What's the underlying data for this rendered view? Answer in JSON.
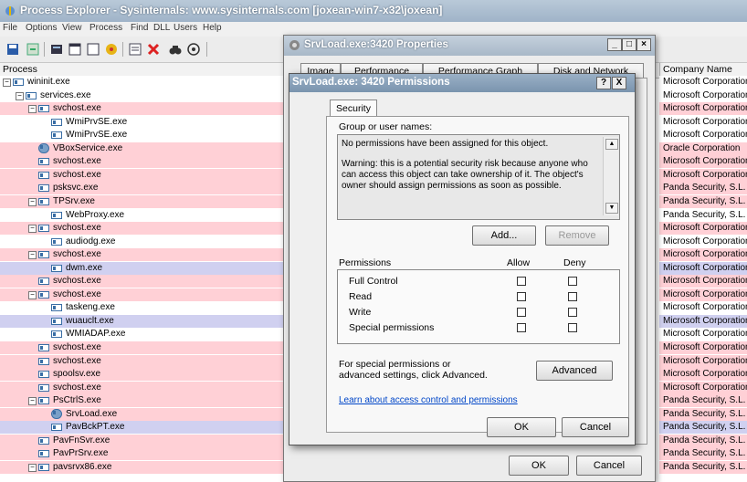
{
  "window": {
    "title": "Process Explorer - Sysinternals: www.sysinternals.com [joxean-win7-x32\\joxean]"
  },
  "menu": [
    "File",
    "Options",
    "View",
    "Process",
    "Find",
    "DLL",
    "Users",
    "Help"
  ],
  "columns": {
    "process": "Process",
    "company": "Company Name"
  },
  "processes": [
    {
      "name": "wininit.exe",
      "indent": 0,
      "toggle": "minus",
      "bg": "#ffffff"
    },
    {
      "name": "services.exe",
      "indent": 1,
      "toggle": "minus",
      "bg": "#ffffff"
    },
    {
      "name": "svchost.exe",
      "indent": 2,
      "toggle": "minus",
      "bg": "#ffd0d6"
    },
    {
      "name": "WmiPrvSE.exe",
      "indent": 3,
      "toggle": "",
      "bg": "#ffffff"
    },
    {
      "name": "WmiPrvSE.exe",
      "indent": 3,
      "toggle": "",
      "bg": "#ffffff"
    },
    {
      "name": "VBoxService.exe",
      "indent": 2,
      "toggle": "",
      "bg": "#ffd0d6",
      "icon": "gear"
    },
    {
      "name": "svchost.exe",
      "indent": 2,
      "toggle": "",
      "bg": "#ffd0d6"
    },
    {
      "name": "svchost.exe",
      "indent": 2,
      "toggle": "",
      "bg": "#ffd0d6"
    },
    {
      "name": "psksvc.exe",
      "indent": 2,
      "toggle": "",
      "bg": "#ffd0d6"
    },
    {
      "name": "TPSrv.exe",
      "indent": 2,
      "toggle": "minus",
      "bg": "#ffd0d6"
    },
    {
      "name": "WebProxy.exe",
      "indent": 3,
      "toggle": "",
      "bg": "#ffffff"
    },
    {
      "name": "svchost.exe",
      "indent": 2,
      "toggle": "minus",
      "bg": "#ffd0d6"
    },
    {
      "name": "audiodg.exe",
      "indent": 3,
      "toggle": "",
      "bg": "#ffffff"
    },
    {
      "name": "svchost.exe",
      "indent": 2,
      "toggle": "minus",
      "bg": "#ffd0d6"
    },
    {
      "name": "dwm.exe",
      "indent": 3,
      "toggle": "",
      "bg": "#d0d0f0"
    },
    {
      "name": "svchost.exe",
      "indent": 2,
      "toggle": "",
      "bg": "#ffd0d6"
    },
    {
      "name": "svchost.exe",
      "indent": 2,
      "toggle": "minus",
      "bg": "#ffd0d6"
    },
    {
      "name": "taskeng.exe",
      "indent": 3,
      "toggle": "",
      "bg": "#ffffff"
    },
    {
      "name": "wuauclt.exe",
      "indent": 3,
      "toggle": "",
      "bg": "#d0d0f0"
    },
    {
      "name": "WMIADAP.exe",
      "indent": 3,
      "toggle": "",
      "bg": "#ffffff"
    },
    {
      "name": "svchost.exe",
      "indent": 2,
      "toggle": "",
      "bg": "#ffd0d6"
    },
    {
      "name": "svchost.exe",
      "indent": 2,
      "toggle": "",
      "bg": "#ffd0d6"
    },
    {
      "name": "spoolsv.exe",
      "indent": 2,
      "toggle": "",
      "bg": "#ffd0d6"
    },
    {
      "name": "svchost.exe",
      "indent": 2,
      "toggle": "",
      "bg": "#ffd0d6"
    },
    {
      "name": "PsCtrlS.exe",
      "indent": 2,
      "toggle": "minus",
      "bg": "#ffd0d6"
    },
    {
      "name": "SrvLoad.exe",
      "indent": 3,
      "toggle": "",
      "bg": "#ffd0d6",
      "icon": "gear"
    },
    {
      "name": "PavBckPT.exe",
      "indent": 3,
      "toggle": "",
      "bg": "#d0d0f0"
    },
    {
      "name": "PavFnSvr.exe",
      "indent": 2,
      "toggle": "",
      "bg": "#ffd0d6"
    },
    {
      "name": "PavPrSrv.exe",
      "indent": 2,
      "toggle": "",
      "bg": "#ffd0d6"
    },
    {
      "name": "pavsrvx86.exe",
      "indent": 2,
      "toggle": "minus",
      "bg": "#ffd0d6"
    }
  ],
  "companies": [
    {
      "name": "Microsoft Corporation",
      "bg": "#ffffff"
    },
    {
      "name": "Microsoft Corporation",
      "bg": "#ffffff"
    },
    {
      "name": "Microsoft Corporation",
      "bg": "#ffd0d6"
    },
    {
      "name": "Microsoft Corporation",
      "bg": "#ffffff"
    },
    {
      "name": "Microsoft Corporation",
      "bg": "#ffffff"
    },
    {
      "name": "Oracle Corporation",
      "bg": "#ffd0d6"
    },
    {
      "name": "Microsoft Corporation",
      "bg": "#ffd0d6"
    },
    {
      "name": "Microsoft Corporation",
      "bg": "#ffd0d6"
    },
    {
      "name": "Panda Security, S.L.",
      "bg": "#ffd0d6"
    },
    {
      "name": "Panda Security, S.L.",
      "bg": "#ffd0d6"
    },
    {
      "name": "Panda Security, S.L.",
      "bg": "#ffffff"
    },
    {
      "name": "Microsoft Corporation",
      "bg": "#ffd0d6"
    },
    {
      "name": "Microsoft Corporation",
      "bg": "#ffffff"
    },
    {
      "name": "Microsoft Corporation",
      "bg": "#ffd0d6"
    },
    {
      "name": "Microsoft Corporation",
      "bg": "#d0d0f0"
    },
    {
      "name": "Microsoft Corporation",
      "bg": "#ffd0d6"
    },
    {
      "name": "Microsoft Corporation",
      "bg": "#ffd0d6"
    },
    {
      "name": "Microsoft Corporation",
      "bg": "#ffffff"
    },
    {
      "name": "Microsoft Corporation",
      "bg": "#d0d0f0"
    },
    {
      "name": "Microsoft Corporation",
      "bg": "#ffffff"
    },
    {
      "name": "Microsoft Corporation",
      "bg": "#ffd0d6"
    },
    {
      "name": "Microsoft Corporation",
      "bg": "#ffd0d6"
    },
    {
      "name": "Microsoft Corporation",
      "bg": "#ffd0d6"
    },
    {
      "name": "Microsoft Corporation",
      "bg": "#ffd0d6"
    },
    {
      "name": "Panda Security, S.L.",
      "bg": "#ffd0d6"
    },
    {
      "name": "Panda Security, S.L.",
      "bg": "#ffd0d6"
    },
    {
      "name": "Panda Security, S.L.",
      "bg": "#d0d0f0"
    },
    {
      "name": "Panda Security, S.L.",
      "bg": "#ffd0d6"
    },
    {
      "name": "Panda Security, S.L.",
      "bg": "#ffd0d6"
    },
    {
      "name": "Panda Security, S.L.",
      "bg": "#ffd0d6"
    }
  ],
  "props": {
    "title": "SrvLoad.exe:3420 Properties",
    "tabs": [
      "Image",
      "Performance",
      "Performance Graph",
      "Disk and Network"
    ],
    "ok": "OK",
    "cancel": "Cancel"
  },
  "perm": {
    "title": "SrvLoad.exe: 3420 Permissions",
    "help": "?",
    "close": "X",
    "tab": "Security",
    "group_label": "Group or user names:",
    "msg1": "No permissions have been assigned for this object.",
    "msg2": "Warning: this is a potential security risk because anyone who can access this object can take ownership of it. The object's owner should assign permissions as soon as possible.",
    "add": "Add...",
    "remove": "Remove",
    "perm_header": "Permissions",
    "allow": "Allow",
    "deny": "Deny",
    "rows": [
      "Full Control",
      "Read",
      "Write",
      "Special permissions"
    ],
    "special_text": "For special permissions or advanced settings, click Advanced.",
    "advanced": "Advanced",
    "learn": "Learn about access control and permissions",
    "ok": "OK",
    "cancel": "Cancel"
  }
}
